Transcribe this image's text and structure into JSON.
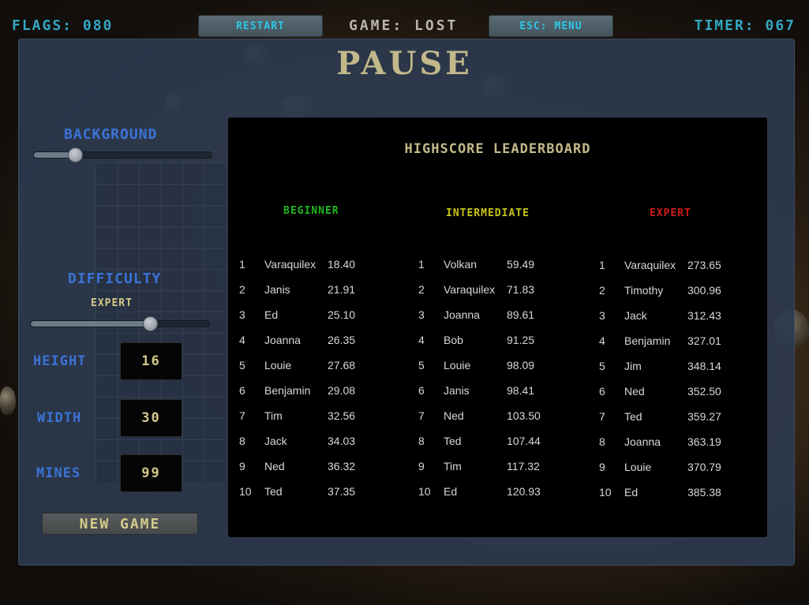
{
  "hud": {
    "flags": "FLAGS: 080",
    "restart_label": "RESTART",
    "game_status": "GAME: LOST",
    "menu_label": "ESC: MENU",
    "timer": "TIMER: 067"
  },
  "pause": {
    "title": "PAUSE"
  },
  "settings": {
    "background_label": "BACKGROUND",
    "background_level": 0.23,
    "difficulty_label": "DIFFICULTY",
    "difficulty_value": "EXPERT",
    "difficulty_level": 0.67,
    "height_label": "HEIGHT",
    "height_value": "16",
    "width_label": "WIDTH",
    "width_value": "30",
    "mines_label": "MINES",
    "mines_value": "99",
    "new_game_label": "NEW GAME"
  },
  "leaderboard": {
    "title": "HIGHSCORE LEADERBOARD",
    "columns": [
      {
        "heading": "BEGINNER",
        "color": "#1fb71f",
        "entries": [
          {
            "rank": "1",
            "name": "Varaquilex",
            "time": "18.40"
          },
          {
            "rank": "2",
            "name": "Janis",
            "time": "21.91"
          },
          {
            "rank": "3",
            "name": "Ed",
            "time": "25.10"
          },
          {
            "rank": "4",
            "name": "Joanna",
            "time": "26.35"
          },
          {
            "rank": "5",
            "name": "Louie",
            "time": "27.68"
          },
          {
            "rank": "6",
            "name": "Benjamin",
            "time": "29.08"
          },
          {
            "rank": "7",
            "name": "Tim",
            "time": "32.56"
          },
          {
            "rank": "8",
            "name": "Jack",
            "time": "34.03"
          },
          {
            "rank": "9",
            "name": "Ned",
            "time": "36.32"
          },
          {
            "rank": "10",
            "name": "Ted",
            "time": "37.35"
          }
        ]
      },
      {
        "heading": "INTERMEDIATE",
        "color": "#c7c41a",
        "entries": [
          {
            "rank": "1",
            "name": "Volkan",
            "time": "59.49"
          },
          {
            "rank": "2",
            "name": "Varaquilex",
            "time": "71.83"
          },
          {
            "rank": "3",
            "name": "Joanna",
            "time": "89.61"
          },
          {
            "rank": "4",
            "name": "Bob",
            "time": "91.25"
          },
          {
            "rank": "5",
            "name": "Louie",
            "time": "98.09"
          },
          {
            "rank": "6",
            "name": "Janis",
            "time": "98.41"
          },
          {
            "rank": "7",
            "name": "Ned",
            "time": "103.50"
          },
          {
            "rank": "8",
            "name": "Ted",
            "time": "107.44"
          },
          {
            "rank": "9",
            "name": "Tim",
            "time": "117.32"
          },
          {
            "rank": "10",
            "name": "Ed",
            "time": "120.93"
          }
        ]
      },
      {
        "heading": "EXPERT",
        "color": "#d01b1b",
        "entries": [
          {
            "rank": "1",
            "name": "Varaquilex",
            "time": "273.65"
          },
          {
            "rank": "2",
            "name": "Timothy",
            "time": "300.96"
          },
          {
            "rank": "3",
            "name": "Jack",
            "time": "312.43"
          },
          {
            "rank": "4",
            "name": "Benjamin",
            "time": "327.01"
          },
          {
            "rank": "5",
            "name": "Jim",
            "time": "348.14"
          },
          {
            "rank": "6",
            "name": "Ned",
            "time": "352.50"
          },
          {
            "rank": "7",
            "name": "Ted",
            "time": "359.27"
          },
          {
            "rank": "8",
            "name": "Joanna",
            "time": "363.19"
          },
          {
            "rank": "9",
            "name": "Louie",
            "time": "370.79"
          },
          {
            "rank": "10",
            "name": "Ed",
            "time": "385.38"
          }
        ]
      }
    ]
  }
}
